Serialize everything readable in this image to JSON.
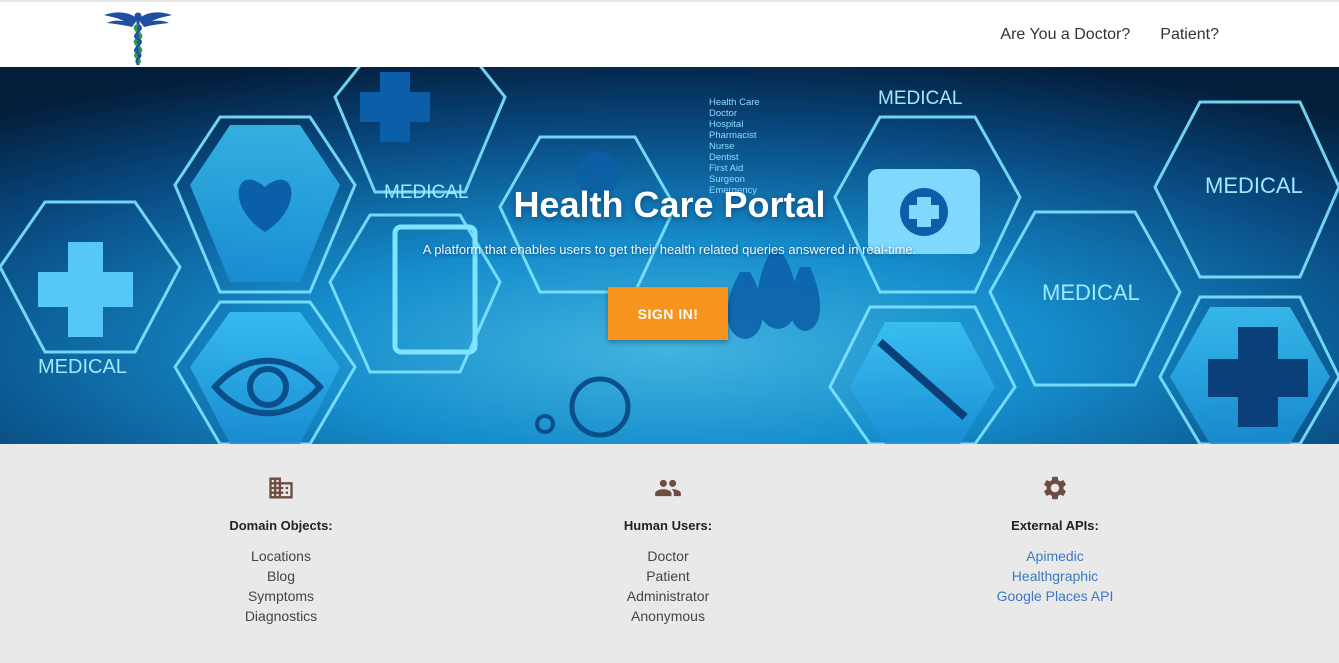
{
  "nav": {
    "logo_icon": "caduceus-icon",
    "links": [
      {
        "label": "Are You a Doctor?"
      },
      {
        "label": "Patient?"
      }
    ]
  },
  "hero": {
    "title": "Health Care Portal",
    "subtitle": "A platform that enables users to get their health related queries answered in real-time.",
    "sign_in_label": "SIGN IN!",
    "background_words": {
      "medical": "MEDICAL",
      "list": [
        "Health Care",
        "Doctor",
        "Hospital",
        "Pharmacist",
        "Nurse",
        "Dentist",
        "First Aid",
        "Surgeon",
        "Emergency"
      ]
    }
  },
  "features": [
    {
      "icon": "building-icon",
      "title": "Domain Objects:",
      "items": [
        "Locations",
        "Blog",
        "Symptoms",
        "Diagnostics"
      ]
    },
    {
      "icon": "people-icon",
      "title": "Human Users:",
      "items": [
        "Doctor",
        "Patient",
        "Administrator",
        "Anonymous"
      ]
    },
    {
      "icon": "gear-icon",
      "title": "External APIs:",
      "items": [
        "Apimedic",
        "Healthgraphic",
        "Google Places API"
      ]
    }
  ],
  "colors": {
    "accent_orange": "#f7941d",
    "link_blue": "#3c78c3",
    "icon_brown": "#6d4c41",
    "hero_blue": "#1aa3e8"
  }
}
